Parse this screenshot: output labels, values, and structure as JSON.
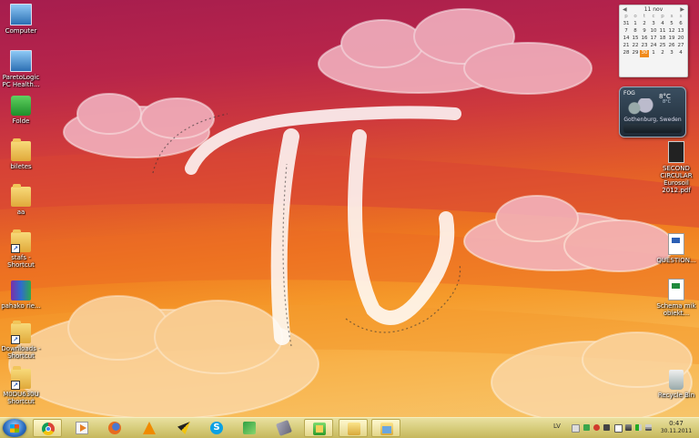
{
  "desktop": {
    "icons_left": [
      {
        "label": "Computer",
        "icon": "computer-icon"
      },
      {
        "label": "ParetoLogic PC Health...",
        "icon": "pc-health-icon"
      },
      {
        "label": "Folde",
        "icon": "folder-shortcut-icon"
      },
      {
        "label": "biletes",
        "icon": "folder-icon"
      },
      {
        "label": "aa",
        "icon": "folder-icon"
      },
      {
        "label": "stafs - Shortcut",
        "icon": "folder-shortcut-icon"
      },
      {
        "label": "pahako rie...",
        "icon": "archive-icon"
      },
      {
        "label": "Downloads - Shortcut",
        "icon": "folder-shortcut-icon"
      },
      {
        "label": "M0DU630U Shortcut",
        "icon": "folder-shortcut-icon"
      }
    ],
    "icons_right": [
      {
        "label": "SECOND CIRCULAR Eurosoil 2012.pdf",
        "icon": "pdf-icon"
      },
      {
        "label": "QUESTION...",
        "icon": "word-document-icon"
      },
      {
        "label": "Schema mik obiekt...",
        "icon": "excel-document-icon"
      },
      {
        "label": "Recycle Bin",
        "icon": "recycle-bin-icon"
      }
    ]
  },
  "calendar": {
    "month_label": "11 nov",
    "weekdays": [
      "p",
      "o",
      "t",
      "c",
      "p",
      "s",
      "s"
    ],
    "days": [
      "31",
      "1",
      "2",
      "3",
      "4",
      "5",
      "6",
      "7",
      "8",
      "9",
      "10",
      "11",
      "12",
      "13",
      "14",
      "15",
      "16",
      "17",
      "18",
      "19",
      "20",
      "21",
      "22",
      "23",
      "24",
      "25",
      "26",
      "27",
      "28",
      "29",
      "30",
      "1",
      "2",
      "3",
      "4"
    ],
    "today": "30"
  },
  "weather": {
    "condition": "FOG",
    "temperature": "8°C",
    "unit_label": "8°C",
    "location": "Gothenburg, Sweden"
  },
  "taskbar": {
    "apps": [
      {
        "name": "google-chrome",
        "icon": "chrome-icon",
        "active": true
      },
      {
        "name": "media-player",
        "icon": "media-player-icon",
        "active": false
      },
      {
        "name": "firefox",
        "icon": "firefox-icon",
        "active": false
      },
      {
        "name": "vlc",
        "icon": "vlc-icon",
        "active": false
      },
      {
        "name": "winamp",
        "icon": "winamp-icon",
        "active": false
      },
      {
        "name": "skype",
        "icon": "skype-icon",
        "active": false
      },
      {
        "name": "sync",
        "icon": "sync-icon",
        "active": false
      },
      {
        "name": "tools",
        "icon": "tools-icon",
        "active": false
      },
      {
        "name": "app-green",
        "icon": "green-app-icon",
        "active": true
      },
      {
        "name": "folder-window",
        "icon": "folder-window-icon",
        "active": true
      },
      {
        "name": "windows-explorer",
        "icon": "explorer-icon",
        "active": true
      }
    ],
    "tray": {
      "language": "LV",
      "time": "0:47",
      "date": "30.11.2011"
    }
  },
  "colors": {
    "taskbar": "#d9cf80",
    "wallpaper_top": "#a61d4e",
    "wallpaper_bottom": "#f7c56a",
    "calendar_today": "#f08a1a"
  }
}
